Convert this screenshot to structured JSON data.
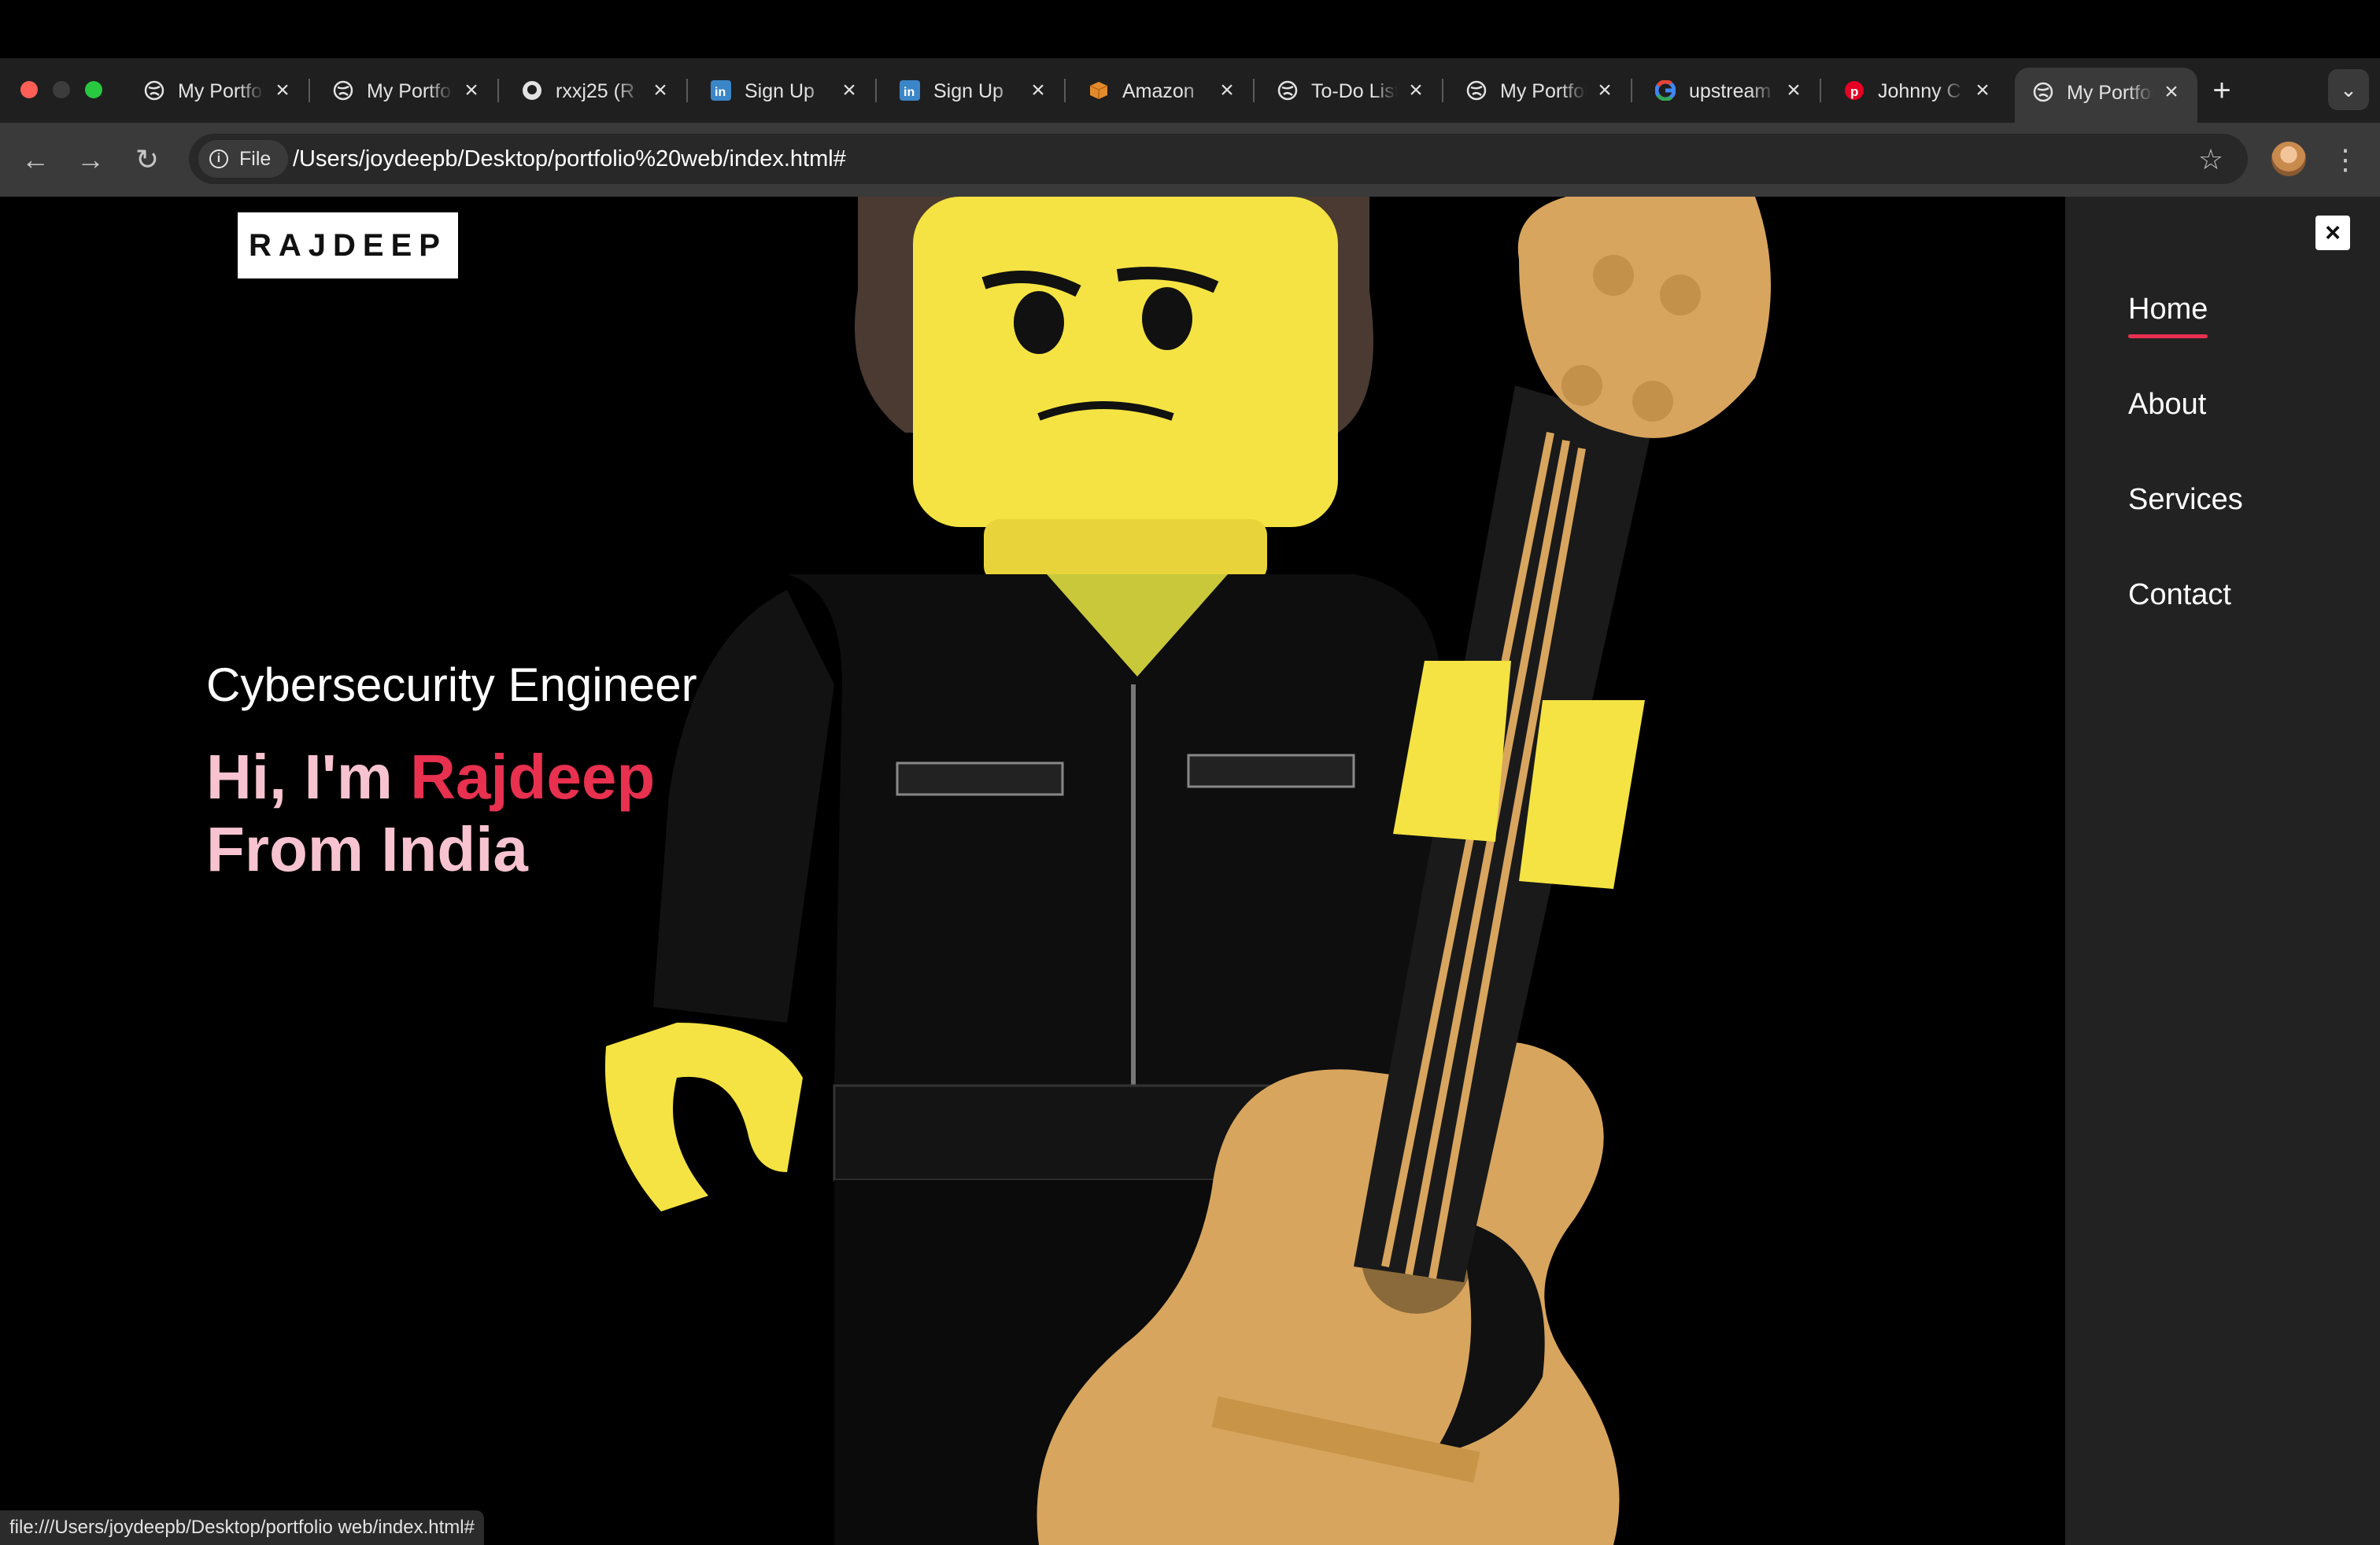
{
  "browser": {
    "tabs": [
      {
        "title": "My Portfolio",
        "favicon": "globe-icon"
      },
      {
        "title": "My Portfolio",
        "favicon": "globe-icon"
      },
      {
        "title": "rxxj25 (R",
        "favicon": "github-icon"
      },
      {
        "title": "Sign Up",
        "favicon": "linkedin-icon"
      },
      {
        "title": "Sign Up",
        "favicon": "linkedin-icon"
      },
      {
        "title": "Amazon",
        "favicon": "amazon-box-icon"
      },
      {
        "title": "To-Do List",
        "favicon": "globe-icon"
      },
      {
        "title": "My Portfolio",
        "favicon": "globe-icon"
      },
      {
        "title": "upstream",
        "favicon": "google-icon"
      },
      {
        "title": "Johnny C",
        "favicon": "pinterest-icon"
      },
      {
        "title": "My Portfolio",
        "favicon": "globe-icon",
        "active": true
      }
    ],
    "chip_label": "File",
    "url": "/Users/joydeepb/Desktop/portfolio%20web/index.html#",
    "status_url": "file:///Users/joydeepb/Desktop/portfolio web/index.html#"
  },
  "site": {
    "logo": "RAJDEEP",
    "role": "Cybersecurity Engineer",
    "greeting_prefix": "Hi, I'm ",
    "name": "Rajdeep",
    "origin": "From India",
    "nav": [
      {
        "label": "Home",
        "active": true
      },
      {
        "label": "About"
      },
      {
        "label": "Services"
      },
      {
        "label": "Contact"
      }
    ],
    "close_symbol": "×"
  },
  "colors": {
    "accent": "#e8304f",
    "greeting": "#f7c3d0",
    "sidebar": "#222222",
    "page_bg": "#000000"
  }
}
